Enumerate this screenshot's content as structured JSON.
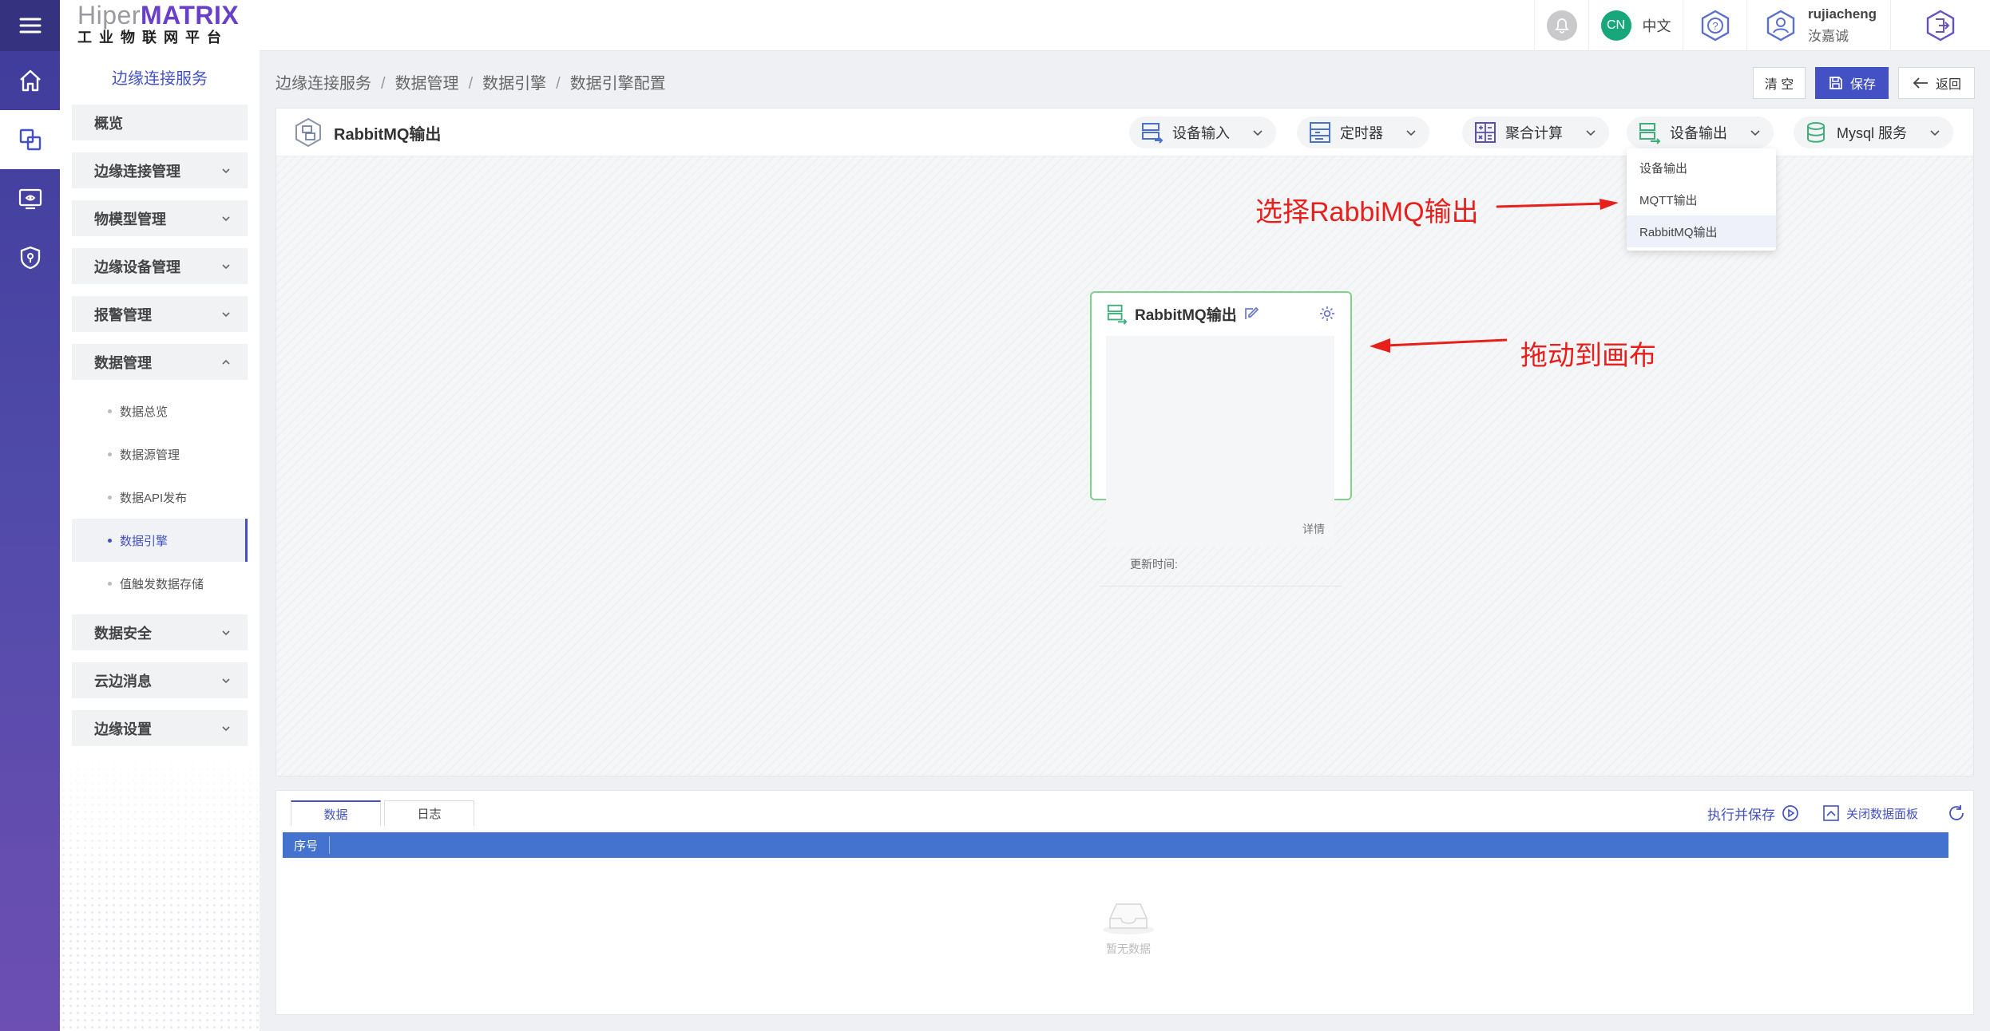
{
  "brand": {
    "logo_prefix": "Hiper",
    "logo_suffix": "MATRIX",
    "logo_subtitle": "工业物联网平台"
  },
  "sidebar": {
    "title": "边缘连接服务",
    "groups": [
      {
        "label": "概览",
        "has_chevron": false
      },
      {
        "label": "边缘连接管理",
        "has_chevron": true
      },
      {
        "label": "物模型管理",
        "has_chevron": true
      },
      {
        "label": "边缘设备管理",
        "has_chevron": true
      },
      {
        "label": "报警管理",
        "has_chevron": true
      },
      {
        "label": "数据管理",
        "has_chevron": true,
        "expanded": true
      },
      {
        "label": "数据安全",
        "has_chevron": true
      },
      {
        "label": "云边消息",
        "has_chevron": true
      },
      {
        "label": "边缘设置",
        "has_chevron": true
      }
    ],
    "data_mgmt_items": [
      "数据总览",
      "数据源管理",
      "数据API发布",
      "数据引擎",
      "值触发数据存储"
    ],
    "active_item": "数据引擎"
  },
  "header": {
    "lang_code": "CN",
    "lang_label": "中文",
    "username": "rujiacheng",
    "display_name": "汝嘉诚"
  },
  "breadcrumb": [
    "边缘连接服务",
    "数据管理",
    "数据引擎",
    "数据引擎配置"
  ],
  "actions": {
    "clear": "清 空",
    "save": "保存",
    "back": "返回"
  },
  "toolbar": {
    "title": "RabbitMQ输出",
    "pills": [
      "设备输入",
      "定时器",
      "聚合计算",
      "设备输出",
      "Mysql 服务"
    ]
  },
  "dropdown": {
    "items": [
      "设备输出",
      "MQTT输出",
      "RabbitMQ输出"
    ],
    "highlighted": "RabbitMQ输出"
  },
  "node": {
    "title": "RabbitMQ输出",
    "detail_label": "详情",
    "update_time_label": "更新时间:"
  },
  "annotations": {
    "select": "选择RabbiMQ输出",
    "drag": "拖动到画布"
  },
  "data_panel": {
    "tabs": [
      "数据",
      "日志"
    ],
    "active_tab": "数据",
    "run_save": "执行并保存",
    "close_panel": "关闭数据面板",
    "columns": [
      "序号"
    ],
    "empty_text": "暂无数据"
  },
  "colors": {
    "primary": "#4351c4",
    "rail_top": "#3f3b9a",
    "rail_bottom": "#6d4fb2",
    "node_border": "#7ed28a",
    "annotation": "#e8201c",
    "lang_badge": "#18a77a",
    "table_header": "#4472cf"
  }
}
